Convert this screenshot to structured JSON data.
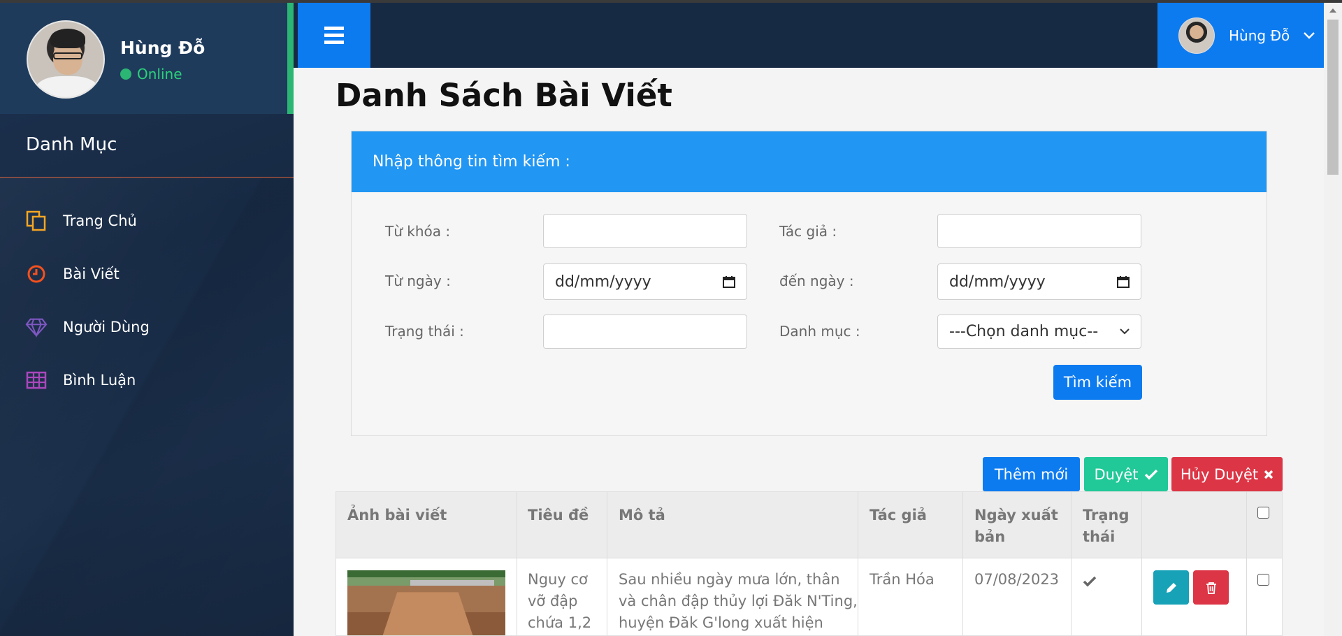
{
  "sidebar": {
    "user_name": "Hùng Đỗ",
    "status": "Online",
    "menu_heading": "Danh Mục",
    "items": [
      {
        "label": "Trang Chủ",
        "icon": "copy-icon",
        "color": "#f5a623"
      },
      {
        "label": "Bài Viết",
        "icon": "clock-icon",
        "color": "#f4511e"
      },
      {
        "label": "Người Dùng",
        "icon": "diamond-icon",
        "color": "#7e57c2"
      },
      {
        "label": "Bình Luận",
        "icon": "table-icon",
        "color": "#ab47bc"
      }
    ]
  },
  "header": {
    "user_name": "Hùng Đỗ"
  },
  "page": {
    "title": "Danh Sách Bài Viết"
  },
  "search": {
    "panel_title": "Nhập thông tin tìm kiếm :",
    "keyword_label": "Từ khóa :",
    "author_label": "Tác giả :",
    "from_date_label": "Từ ngày :",
    "to_date_label": "đến ngày :",
    "status_label": "Trạng thái :",
    "category_label": "Danh mục :",
    "date_placeholder": "dd/mm/yyyy",
    "category_selected": "---Chọn danh mục--",
    "search_button": "Tìm kiếm"
  },
  "actions": {
    "add_new": "Thêm mới",
    "approve": "Duyệt",
    "cancel_approve": "Hủy Duyệt"
  },
  "table": {
    "headers": [
      "Ảnh bài viết",
      "Tiêu đề",
      "Mô tả",
      "Tác giả",
      "Ngày xuất",
      "bản",
      "Trạng",
      "thái"
    ],
    "rows": [
      {
        "title_lines": [
          "Nguy cơ",
          "vỡ đập",
          "chứa 1,2"
        ],
        "desc_lines": [
          "Sau nhiều ngày mưa lớn, thân",
          "và chân đập thủy lợi Đăk N'Ting,",
          "huyện Đăk G'long xuất hiện"
        ],
        "author": "Trần Hóa",
        "date": "07/08/2023"
      }
    ]
  },
  "colors": {
    "primary": "#0d7bf0",
    "success": "#20c997",
    "danger": "#dc3545",
    "info": "#17a2b8",
    "panel_header": "#2196f3"
  }
}
